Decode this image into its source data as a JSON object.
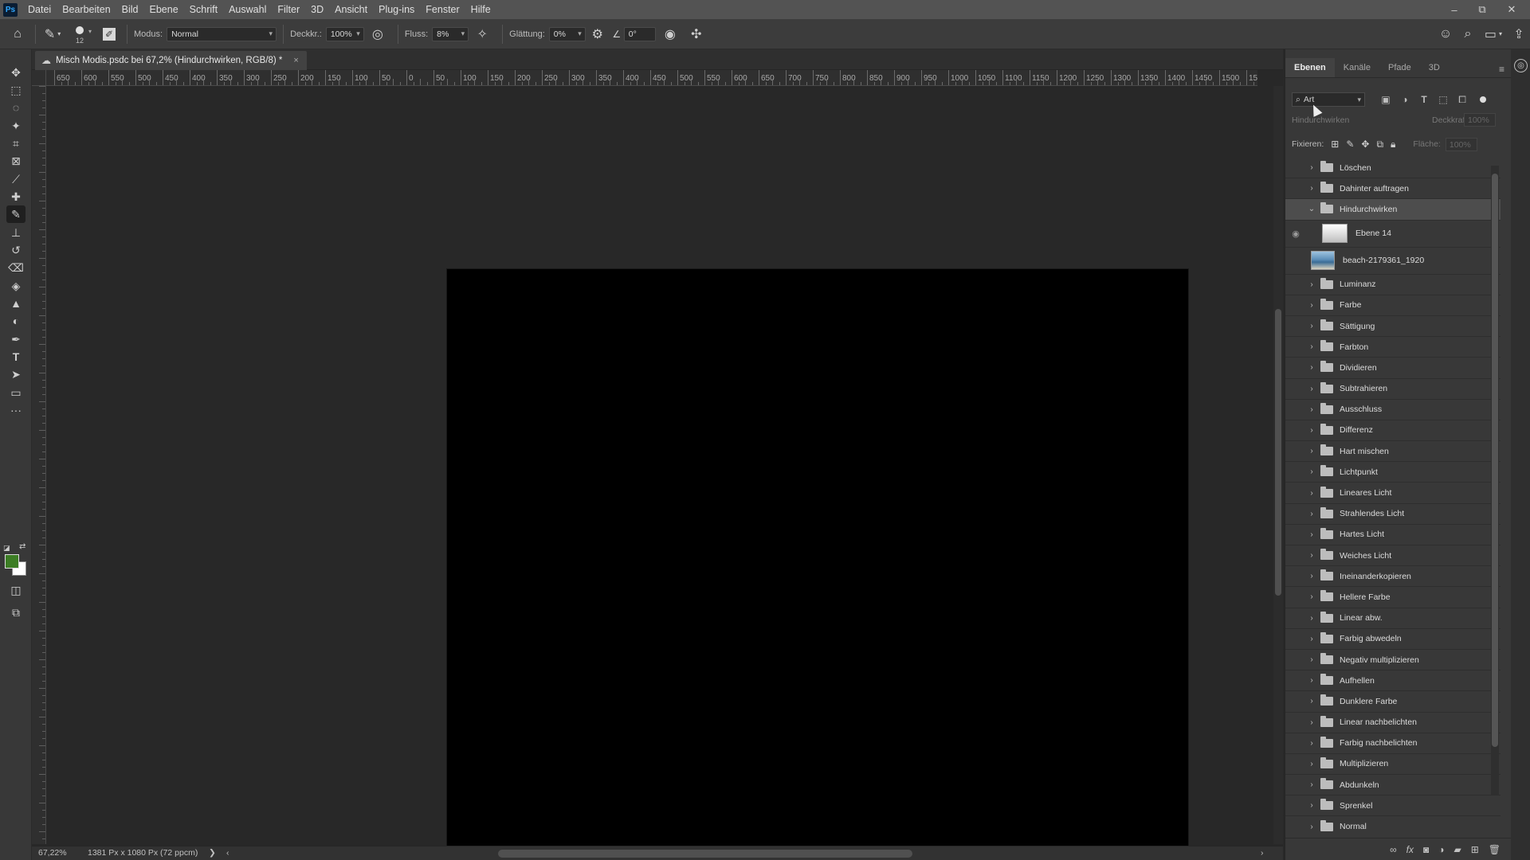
{
  "app": {
    "logo": "Ps"
  },
  "menu": [
    "Datei",
    "Bearbeiten",
    "Bild",
    "Ebene",
    "Schrift",
    "Auswahl",
    "Filter",
    "3D",
    "Ansicht",
    "Plug-ins",
    "Fenster",
    "Hilfe"
  ],
  "window_controls": {
    "minimize": "–",
    "restore": "⧉",
    "close": "✕"
  },
  "options": {
    "brush_size": "12",
    "mode_label": "Modus:",
    "mode_value": "Normal",
    "opacity_label": "Deckkr.:",
    "opacity_value": "100%",
    "flow_label": "Fluss:",
    "flow_value": "8%",
    "smoothing_label": "Glättung:",
    "smoothing_value": "0%",
    "angle_value": "0°"
  },
  "document": {
    "tab_title": "Misch Modis.psdc bei 67,2% (Hindurchwirken, RGB/8) *",
    "close_symbol": "×"
  },
  "rulers": {
    "h_labels": [
      "650",
      "600",
      "550",
      "500",
      "450",
      "400",
      "350",
      "300",
      "250",
      "200",
      "150",
      "100",
      "50",
      "0",
      "50",
      "100",
      "150",
      "200",
      "250",
      "300",
      "350",
      "400",
      "450",
      "500",
      "550",
      "600",
      "650",
      "700",
      "750",
      "800",
      "850",
      "900",
      "950",
      "1000",
      "1050",
      "1100",
      "1150",
      "1200",
      "1250",
      "1300",
      "1350",
      "1400",
      "1450",
      "1500",
      "155"
    ]
  },
  "status": {
    "zoom": "67,22%",
    "doc_size": "1381 Px x 1080 Px (72 ppcm)",
    "arrow": "❯",
    "left_arrow": "‹",
    "right_arrow": "›"
  },
  "panel": {
    "tabs": [
      "Ebenen",
      "Kanäle",
      "Pfade",
      "3D"
    ],
    "filter_value": "Art",
    "blend_value": "Hindurchwirken",
    "opacity_label": "Deckkraft:",
    "opacity_value": "100%",
    "lock_label": "Fixieren:",
    "fill_label": "Fläche:",
    "fill_value": "100%",
    "layers": [
      {
        "name": "Löschen",
        "type": "group"
      },
      {
        "name": "Dahinter auftragen",
        "type": "group"
      },
      {
        "name": "Hindurchwirken",
        "type": "group",
        "expanded": true,
        "selected": true
      },
      {
        "name": "Ebene 14",
        "type": "pixel",
        "visible": true
      },
      {
        "name": "beach-2179361_1920",
        "type": "smart"
      },
      {
        "name": "Luminanz",
        "type": "group"
      },
      {
        "name": "Farbe",
        "type": "group"
      },
      {
        "name": "Sättigung",
        "type": "group"
      },
      {
        "name": "Farbton",
        "type": "group"
      },
      {
        "name": "Dividieren",
        "type": "group"
      },
      {
        "name": "Subtrahieren",
        "type": "group"
      },
      {
        "name": "Ausschluss",
        "type": "group"
      },
      {
        "name": "Differenz",
        "type": "group"
      },
      {
        "name": "Hart mischen",
        "type": "group"
      },
      {
        "name": "Lichtpunkt",
        "type": "group"
      },
      {
        "name": "Lineares Licht",
        "type": "group"
      },
      {
        "name": "Strahlendes Licht",
        "type": "group"
      },
      {
        "name": "Hartes Licht",
        "type": "group"
      },
      {
        "name": "Weiches Licht",
        "type": "group"
      },
      {
        "name": "Ineinanderkopieren",
        "type": "group"
      },
      {
        "name": "Hellere Farbe",
        "type": "group"
      },
      {
        "name": "Linear abw.",
        "type": "group"
      },
      {
        "name": "Farbig abwedeln",
        "type": "group"
      },
      {
        "name": "Negativ multiplizieren",
        "type": "group"
      },
      {
        "name": "Aufhellen",
        "type": "group"
      },
      {
        "name": "Dunklere Farbe",
        "type": "group"
      },
      {
        "name": "Linear nachbelichten",
        "type": "group"
      },
      {
        "name": "Farbig nachbelichten",
        "type": "group"
      },
      {
        "name": "Multiplizieren",
        "type": "group"
      },
      {
        "name": "Abdunkeln",
        "type": "group"
      },
      {
        "name": "Sprenkel",
        "type": "group"
      },
      {
        "name": "Normal",
        "type": "group"
      }
    ],
    "footer_fx": "fx"
  },
  "colors": {
    "foreground": "#3c7d24",
    "background": "#ffffff"
  }
}
